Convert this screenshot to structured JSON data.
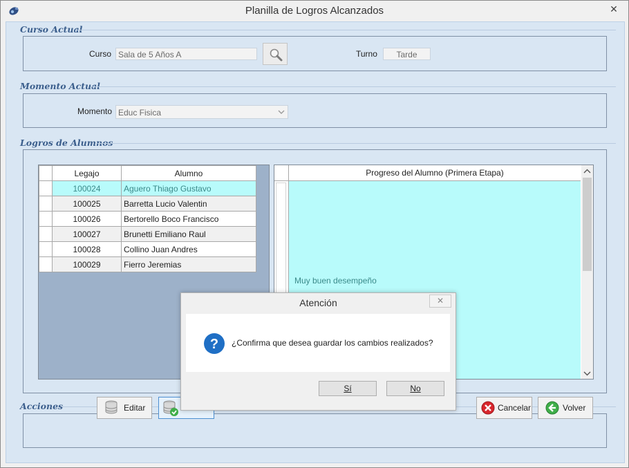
{
  "window": {
    "title": "Planilla de Logros Alcanzados",
    "close_glyph": "✕"
  },
  "curso_actual": {
    "title": "Curso Actual",
    "curso_label": "Curso",
    "curso_value": "Sala de 5 Años A",
    "turno_label": "Turno",
    "turno_value": "Tarde"
  },
  "momento_actual": {
    "title": "Momento Actual",
    "momento_label": "Momento",
    "momento_value": "Educ Fisica"
  },
  "logros": {
    "title": "Logros de Alumnos",
    "columns": {
      "legajo": "Legajo",
      "alumno": "Alumno"
    },
    "rows": [
      {
        "legajo": "100024",
        "alumno": "Aguero Thiago Gustavo"
      },
      {
        "legajo": "100025",
        "alumno": "Barretta Lucio Valentin"
      },
      {
        "legajo": "100026",
        "alumno": "Bertorello Boco Francisco"
      },
      {
        "legajo": "100027",
        "alumno": "Brunetti Emiliano Raul"
      },
      {
        "legajo": "100028",
        "alumno": "Collino Juan Andres"
      },
      {
        "legajo": "100029",
        "alumno": "Fierro Jeremias"
      }
    ],
    "progress_header": "Progreso del Alumno (Primera Etapa)",
    "progress_value": "Muy buen desempeño"
  },
  "dialog": {
    "title": "Atención",
    "close_glyph": "✕",
    "message": "¿Confirma que desea guardar los cambios realizados?",
    "yes": "Sí",
    "no": "No"
  },
  "acciones": {
    "title": "Acciones",
    "editar": "Editar",
    "guardar": "Guardar",
    "cancelar": "Cancelar",
    "volver": "Volver"
  },
  "colors": {
    "selected_row": "#b8fbfb",
    "group_title": "#3c5f8d",
    "panel_bg": "#d9e6f3"
  }
}
